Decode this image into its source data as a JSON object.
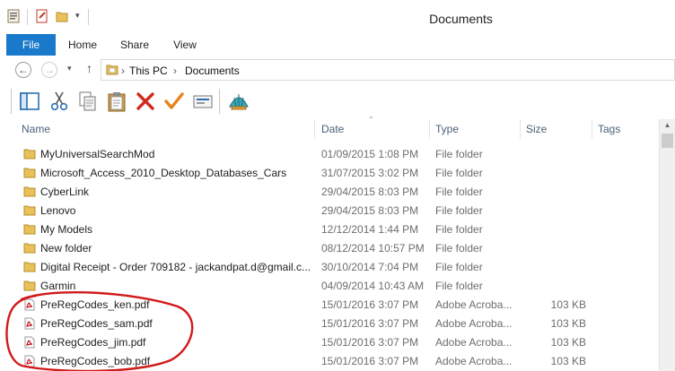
{
  "window": {
    "title": "Documents"
  },
  "ribbon": {
    "tabs": [
      "File",
      "Home",
      "Share",
      "View"
    ]
  },
  "address": {
    "crumbs": [
      "This PC",
      "Documents"
    ]
  },
  "columns": [
    "Name",
    "Date",
    "Type",
    "Size",
    "Tags"
  ],
  "files": [
    {
      "name": "MyUniversalSearchMod",
      "date": "01/09/2015 1:08 PM",
      "type": "File folder",
      "size": "",
      "icon": "folder-icon"
    },
    {
      "name": "Microsoft_Access_2010_Desktop_Databases_Cars",
      "date": "31/07/2015 3:02 PM",
      "type": "File folder",
      "size": "",
      "icon": "folder-icon"
    },
    {
      "name": "CyberLink",
      "date": "29/04/2015 8:03 PM",
      "type": "File folder",
      "size": "",
      "icon": "folder-icon"
    },
    {
      "name": "Lenovo",
      "date": "29/04/2015 8:03 PM",
      "type": "File folder",
      "size": "",
      "icon": "folder-icon"
    },
    {
      "name": "My Models",
      "date": "12/12/2014 1:44 PM",
      "type": "File folder",
      "size": "",
      "icon": "folder-icon"
    },
    {
      "name": "New folder",
      "date": "08/12/2014 10:57 PM",
      "type": "File folder",
      "size": "",
      "icon": "folder-icon"
    },
    {
      "name": "Digital Receipt - Order 709182 - jackandpat.d@gmail.c...",
      "date": "30/10/2014 7:04 PM",
      "type": "File folder",
      "size": "",
      "icon": "folder-icon"
    },
    {
      "name": "Garmin",
      "date": "04/09/2014 10:43 AM",
      "type": "File folder",
      "size": "",
      "icon": "folder-icon"
    },
    {
      "name": "PreRegCodes_ken.pdf",
      "date": "15/01/2016 3:07 PM",
      "type": "Adobe Acroba...",
      "size": "103 KB",
      "icon": "pdf-icon"
    },
    {
      "name": "PreRegCodes_sam.pdf",
      "date": "15/01/2016 3:07 PM",
      "type": "Adobe Acroba...",
      "size": "103 KB",
      "icon": "pdf-icon"
    },
    {
      "name": "PreRegCodes_jim.pdf",
      "date": "15/01/2016 3:07 PM",
      "type": "Adobe Acroba...",
      "size": "103 KB",
      "icon": "pdf-icon"
    },
    {
      "name": "PreRegCodes_bob.pdf",
      "date": "15/01/2016 3:07 PM",
      "type": "Adobe Acroba...",
      "size": "103 KB",
      "icon": "pdf-icon"
    }
  ],
  "colors": {
    "file_tab": "#1979ca",
    "folder": "#e8c15a",
    "pdf": "#c8151b",
    "annotation": "#d11a1a"
  }
}
